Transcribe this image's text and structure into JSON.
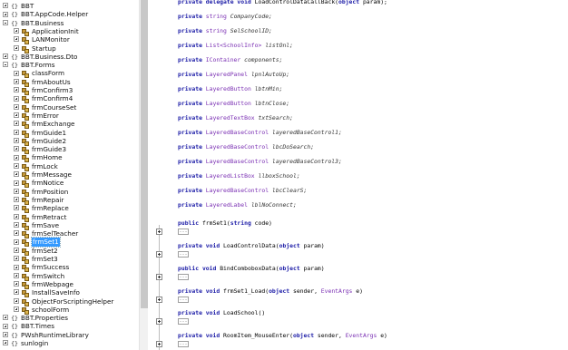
{
  "tree": {
    "rows": [
      {
        "depth": 0,
        "expander": "plus",
        "icon": "ns",
        "label": "BBT"
      },
      {
        "depth": 0,
        "expander": "plus",
        "icon": "ns",
        "label": "BBT.AppCode.Helper"
      },
      {
        "depth": 0,
        "expander": "minus",
        "icon": "ns",
        "label": "BBT.Business"
      },
      {
        "depth": 1,
        "expander": "plus",
        "icon": "cls",
        "label": "ApplicationInit"
      },
      {
        "depth": 1,
        "expander": "plus",
        "icon": "cls",
        "label": "LANMonitor"
      },
      {
        "depth": 1,
        "expander": "plus",
        "icon": "cls",
        "label": "Startup"
      },
      {
        "depth": 0,
        "expander": "plus",
        "icon": "ns",
        "label": "BBT.Business.Dto"
      },
      {
        "depth": 0,
        "expander": "minus",
        "icon": "ns",
        "label": "BBT.Forms"
      },
      {
        "depth": 1,
        "expander": "plus",
        "icon": "cls",
        "label": "classForm"
      },
      {
        "depth": 1,
        "expander": "plus",
        "icon": "cls",
        "label": "frmAboutUs"
      },
      {
        "depth": 1,
        "expander": "plus",
        "icon": "cls",
        "label": "frmConfirm3"
      },
      {
        "depth": 1,
        "expander": "plus",
        "icon": "cls",
        "label": "frmConfirm4"
      },
      {
        "depth": 1,
        "expander": "plus",
        "icon": "cls",
        "label": "frmCourseSet"
      },
      {
        "depth": 1,
        "expander": "plus",
        "icon": "cls",
        "label": "frmError"
      },
      {
        "depth": 1,
        "expander": "plus",
        "icon": "cls",
        "label": "frmExchange"
      },
      {
        "depth": 1,
        "expander": "plus",
        "icon": "cls",
        "label": "frmGuide1"
      },
      {
        "depth": 1,
        "expander": "plus",
        "icon": "cls",
        "label": "frmGuide2"
      },
      {
        "depth": 1,
        "expander": "plus",
        "icon": "cls",
        "label": "frmGuide3"
      },
      {
        "depth": 1,
        "expander": "plus",
        "icon": "cls",
        "label": "frmHome"
      },
      {
        "depth": 1,
        "expander": "plus",
        "icon": "cls",
        "label": "frmLock"
      },
      {
        "depth": 1,
        "expander": "plus",
        "icon": "cls",
        "label": "frmMessage"
      },
      {
        "depth": 1,
        "expander": "plus",
        "icon": "cls",
        "label": "frmNotice"
      },
      {
        "depth": 1,
        "expander": "plus",
        "icon": "cls",
        "label": "frmPosition"
      },
      {
        "depth": 1,
        "expander": "plus",
        "icon": "cls",
        "label": "frmRepair"
      },
      {
        "depth": 1,
        "expander": "plus",
        "icon": "cls",
        "label": "frmReplace"
      },
      {
        "depth": 1,
        "expander": "plus",
        "icon": "cls",
        "label": "frmRetract"
      },
      {
        "depth": 1,
        "expander": "plus",
        "icon": "cls",
        "label": "frmSave"
      },
      {
        "depth": 1,
        "expander": "plus",
        "icon": "cls",
        "label": "frmSelTeacher"
      },
      {
        "depth": 1,
        "expander": "plus",
        "icon": "cls",
        "label": "frmSet1",
        "selected": true
      },
      {
        "depth": 1,
        "expander": "plus",
        "icon": "cls",
        "label": "frmSet2"
      },
      {
        "depth": 1,
        "expander": "plus",
        "icon": "cls",
        "label": "frmSet3"
      },
      {
        "depth": 1,
        "expander": "plus",
        "icon": "cls",
        "label": "frmSuccess"
      },
      {
        "depth": 1,
        "expander": "plus",
        "icon": "cls",
        "label": "frmSwitch"
      },
      {
        "depth": 1,
        "expander": "plus",
        "icon": "cls",
        "label": "frmWebpage"
      },
      {
        "depth": 1,
        "expander": "plus",
        "icon": "cls",
        "label": "InstallSaveInfo"
      },
      {
        "depth": 1,
        "expander": "plus",
        "icon": "cls",
        "label": "ObjectForScriptingHelper"
      },
      {
        "depth": 1,
        "expander": "plus",
        "icon": "cls",
        "label": "schoolForm"
      },
      {
        "depth": 0,
        "expander": "plus",
        "icon": "ns",
        "label": "BBT.Properties"
      },
      {
        "depth": 0,
        "expander": "plus",
        "icon": "ns",
        "label": "BBT.Times"
      },
      {
        "depth": 0,
        "expander": "plus",
        "icon": "ns",
        "label": "PWshRuntimeLibrary"
      },
      {
        "depth": 0,
        "expander": "plus",
        "icon": "ns",
        "label": "sunlogin"
      }
    ]
  },
  "code": {
    "lines": [
      {
        "tokens": [
          [
            "kw",
            "private "
          ],
          [
            "kw",
            "delegate "
          ],
          [
            "kw",
            "void "
          ],
          [
            "nm",
            "LoadControlDataCallBack("
          ],
          [
            "kw",
            "object "
          ],
          [
            "nm",
            "param);"
          ]
        ]
      },
      {
        "tokens": [
          [
            "kw",
            "private "
          ],
          [
            "ty",
            "string "
          ],
          [
            "id",
            "CompanyCode;"
          ]
        ]
      },
      {
        "tokens": [
          [
            "kw",
            "private "
          ],
          [
            "ty",
            "string "
          ],
          [
            "id",
            "SelSchoolID;"
          ]
        ]
      },
      {
        "tokens": [
          [
            "kw",
            "private "
          ],
          [
            "ty",
            "List<SchoolInfo> "
          ],
          [
            "id",
            "listOnl;"
          ]
        ]
      },
      {
        "tokens": [
          [
            "kw",
            "private "
          ],
          [
            "ty",
            "IContainer "
          ],
          [
            "id",
            "components;"
          ]
        ]
      },
      {
        "tokens": [
          [
            "kw",
            "private "
          ],
          [
            "ty",
            "LayeredPanel "
          ],
          [
            "id",
            "lpnlAutoUp;"
          ]
        ]
      },
      {
        "tokens": [
          [
            "kw",
            "private "
          ],
          [
            "ty",
            "LayeredButton "
          ],
          [
            "id",
            "lbtnMin;"
          ]
        ]
      },
      {
        "tokens": [
          [
            "kw",
            "private "
          ],
          [
            "ty",
            "LayeredButton "
          ],
          [
            "id",
            "lbtnClose;"
          ]
        ]
      },
      {
        "tokens": [
          [
            "kw",
            "private "
          ],
          [
            "ty",
            "LayeredTextBox "
          ],
          [
            "id",
            "txtSearch;"
          ]
        ]
      },
      {
        "tokens": [
          [
            "kw",
            "private "
          ],
          [
            "ty",
            "LayeredBaseControl "
          ],
          [
            "id",
            "layeredBaseControl1;"
          ]
        ]
      },
      {
        "tokens": [
          [
            "kw",
            "private "
          ],
          [
            "ty",
            "LayeredBaseControl "
          ],
          [
            "id",
            "lbcDoSearch;"
          ]
        ]
      },
      {
        "tokens": [
          [
            "kw",
            "private "
          ],
          [
            "ty",
            "LayeredBaseControl "
          ],
          [
            "id",
            "layeredBaseControl3;"
          ]
        ]
      },
      {
        "tokens": [
          [
            "kw",
            "private "
          ],
          [
            "ty",
            "LayeredListBox "
          ],
          [
            "id",
            "llboxSchool;"
          ]
        ]
      },
      {
        "tokens": [
          [
            "kw",
            "private "
          ],
          [
            "ty",
            "LayeredBaseControl "
          ],
          [
            "id",
            "lbcClearS;"
          ]
        ]
      },
      {
        "tokens": [
          [
            "kw",
            "private "
          ],
          [
            "ty",
            "LayeredLabel "
          ],
          [
            "id",
            "lblNoConnect;"
          ]
        ]
      },
      {
        "tokens": [
          [
            "kw",
            "public "
          ],
          [
            "nm",
            "frmSet1("
          ],
          [
            "kw",
            "string "
          ],
          [
            "nm",
            "code)"
          ]
        ],
        "collapsed": true
      },
      {
        "tokens": [
          [
            "kw",
            "private "
          ],
          [
            "kw",
            "void "
          ],
          [
            "nm",
            "LoadControlData("
          ],
          [
            "kw",
            "object "
          ],
          [
            "nm",
            "param)"
          ]
        ],
        "collapsed": true
      },
      {
        "tokens": [
          [
            "kw",
            "public "
          ],
          [
            "kw",
            "void "
          ],
          [
            "nm",
            "BindComboboxData("
          ],
          [
            "kw",
            "object "
          ],
          [
            "nm",
            "param)"
          ]
        ],
        "collapsed": true
      },
      {
        "tokens": [
          [
            "kw",
            "private "
          ],
          [
            "kw",
            "void "
          ],
          [
            "nm",
            "frmSet1_Load("
          ],
          [
            "kw",
            "object "
          ],
          [
            "nm",
            "sender, "
          ],
          [
            "ty",
            "EventArgs "
          ],
          [
            "nm",
            "e)"
          ]
        ],
        "collapsed": true
      },
      {
        "tokens": [
          [
            "kw",
            "private "
          ],
          [
            "kw",
            "void "
          ],
          [
            "nm",
            "LoadSchool()"
          ]
        ],
        "collapsed": true
      },
      {
        "tokens": [
          [
            "kw",
            "private "
          ],
          [
            "kw",
            "void "
          ],
          [
            "nm",
            "RoomItem_MouseEnter("
          ],
          [
            "kw",
            "object "
          ],
          [
            "nm",
            "sender, "
          ],
          [
            "ty",
            "EventArgs "
          ],
          [
            "nm",
            "e)"
          ]
        ],
        "collapsed": true
      }
    ],
    "collapsed_marker": "..."
  }
}
